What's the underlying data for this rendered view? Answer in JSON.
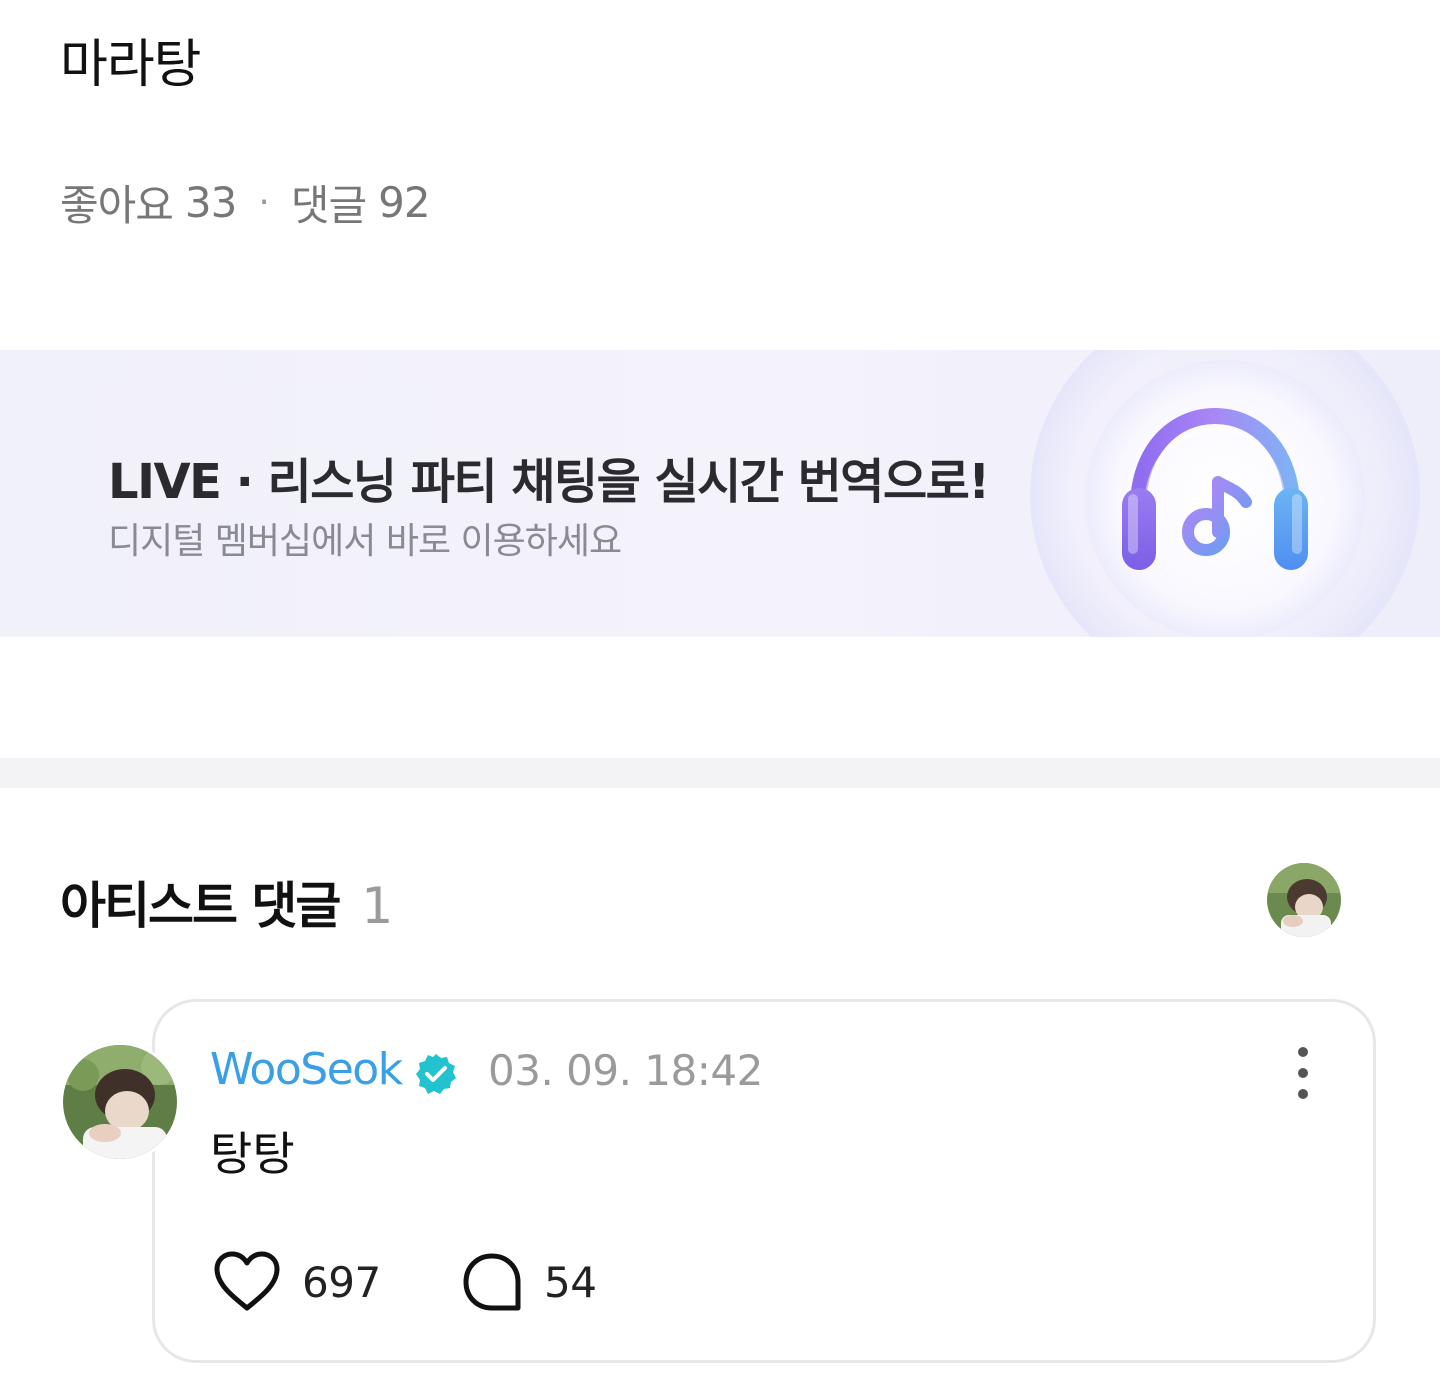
{
  "post": {
    "title": "마라탕",
    "likes_label": "좋아요",
    "likes_count": "33",
    "separator": "·",
    "comments_label": "댓글",
    "comments_count": "92"
  },
  "promo": {
    "title": "LIVE · 리스닝 파티 채팅을 실시간 번역으로!",
    "subtitle": "디지털 멤버십에서 바로 이용하세요",
    "icon": "headphones-music-icon"
  },
  "artist_comments": {
    "heading": "아티스트 댓글",
    "count": "1"
  },
  "comment": {
    "author": "WooSeok",
    "verified_icon": "verified-badge-icon",
    "timestamp": "03. 09. 18:42",
    "text": "탕탕",
    "like_count": "697",
    "reply_count": "54"
  },
  "colors": {
    "author_blue": "#3aa0e6",
    "verified_teal": "#22c3cf",
    "banner_bg": "#f1f1fa",
    "muted_text": "#9a9a9a"
  }
}
